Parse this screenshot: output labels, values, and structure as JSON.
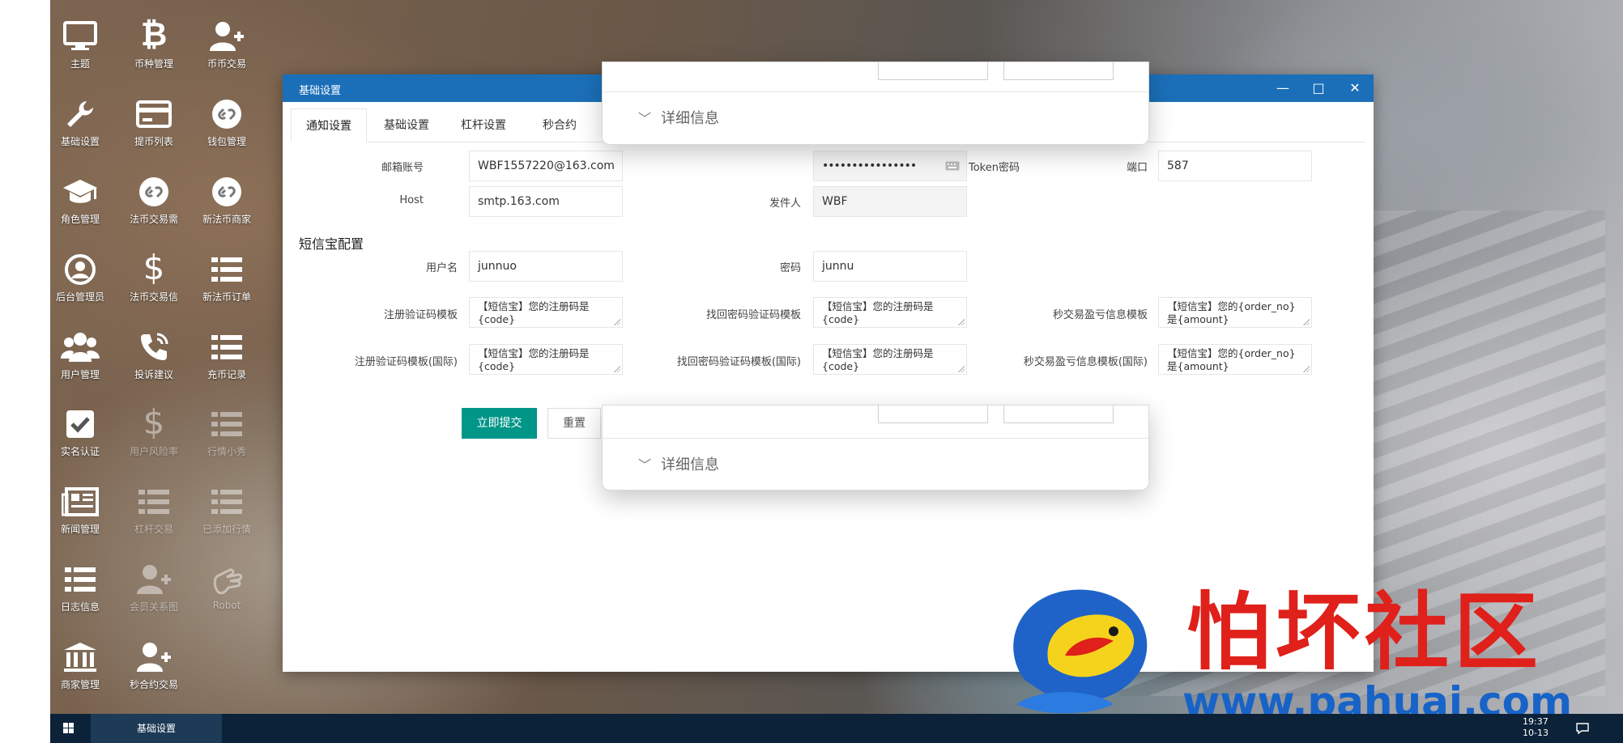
{
  "desktop": {
    "icons": [
      {
        "label": "主题",
        "icon": "monitor-icon"
      },
      {
        "label": "币种管理",
        "icon": "bitcoin-icon"
      },
      {
        "label": "币币交易",
        "icon": "user-plus-icon"
      },
      {
        "label": "基础设置",
        "icon": "wrench-icon"
      },
      {
        "label": "提币列表",
        "icon": "credit-card-icon"
      },
      {
        "label": "钱包管理",
        "icon": "link-circle-icon"
      },
      {
        "label": "角色管理",
        "icon": "graduation-cap-icon"
      },
      {
        "label": "法币交易需",
        "icon": "link-circle-icon"
      },
      {
        "label": "新法币商家",
        "icon": "link-circle-icon"
      },
      {
        "label": "后台管理员",
        "icon": "user-circle-icon"
      },
      {
        "label": "法币交易信",
        "icon": "dollar-icon"
      },
      {
        "label": "新法币订单",
        "icon": "list-icon"
      },
      {
        "label": "用户管理",
        "icon": "users-icon"
      },
      {
        "label": "投诉建议",
        "icon": "phone-icon"
      },
      {
        "label": "充币记录",
        "icon": "list-icon"
      },
      {
        "label": "实名认证",
        "icon": "check-square-icon"
      },
      {
        "label": "用户风险率",
        "icon": "dollar-icon"
      },
      {
        "label": "行情小秀",
        "icon": "list-icon"
      },
      {
        "label": "新闻管理",
        "icon": "newspaper-icon"
      },
      {
        "label": "杠杆交易",
        "icon": "list-icon"
      },
      {
        "label": "已添加行情",
        "icon": "list-icon"
      },
      {
        "label": "日志信息",
        "icon": "list-icon"
      },
      {
        "label": "会员关系图",
        "icon": "user-plus-icon"
      },
      {
        "label": "Robot",
        "icon": "hand-icon"
      },
      {
        "label": "商家管理",
        "icon": "bank-icon"
      },
      {
        "label": "秒合约交易",
        "icon": "user-plus-icon"
      }
    ]
  },
  "window": {
    "title": "基础设置",
    "controls": {
      "minimize": "—",
      "maximize": "□",
      "close": "✕"
    },
    "tabs": [
      "通知设置",
      "基础设置",
      "杠杆设置",
      "秒合约"
    ],
    "email": {
      "account_label": "邮箱账号",
      "account_value": "WBF1557220@163.com",
      "token_label": "Token密码",
      "token_value": "••••••••••••••••",
      "port_label": "端口",
      "port_value": "587",
      "host_label": "Host",
      "host_value": "smtp.163.com",
      "sender_label": "发件人",
      "sender_value": "WBF"
    },
    "sms": {
      "section_title": "短信宝配置",
      "username_label": "用户名",
      "username_value": "junnuo",
      "password_label": "密码",
      "password_value": "junnu",
      "reg_tpl_label": "注册验证码模板",
      "reg_tpl_value": "【短信宝】您的注册码是{code}",
      "find_tpl_label": "找回密码验证码模板",
      "find_tpl_value": "【短信宝】您的注册码是{code}",
      "sec_tpl_label": "秒交易盈亏信息模板",
      "sec_tpl_value": "【短信宝】您的{order_no}是{amount}",
      "reg_tpl_intl_label": "注册验证码模板(国际)",
      "reg_tpl_intl_value": "【短信宝】您的注册码是{code}",
      "find_tpl_intl_label": "找回密码验证码模板(国际)",
      "find_tpl_intl_value": "【短信宝】您的注册码是{code}",
      "sec_tpl_intl_label": "秒交易盈亏信息模板(国际)",
      "sec_tpl_intl_value": "【短信宝】您的{order_no}是{amount}"
    },
    "buttons": {
      "submit": "立即提交",
      "reset": "重置"
    }
  },
  "overlay": {
    "details_label_top": "详细信息",
    "details_label_bottom": "详细信息"
  },
  "watermark": {
    "text": "怕坏社区",
    "url": "www.pahuai.com"
  },
  "taskbar": {
    "task_label": "基础设置",
    "time": "19:37",
    "date": "10-13"
  }
}
